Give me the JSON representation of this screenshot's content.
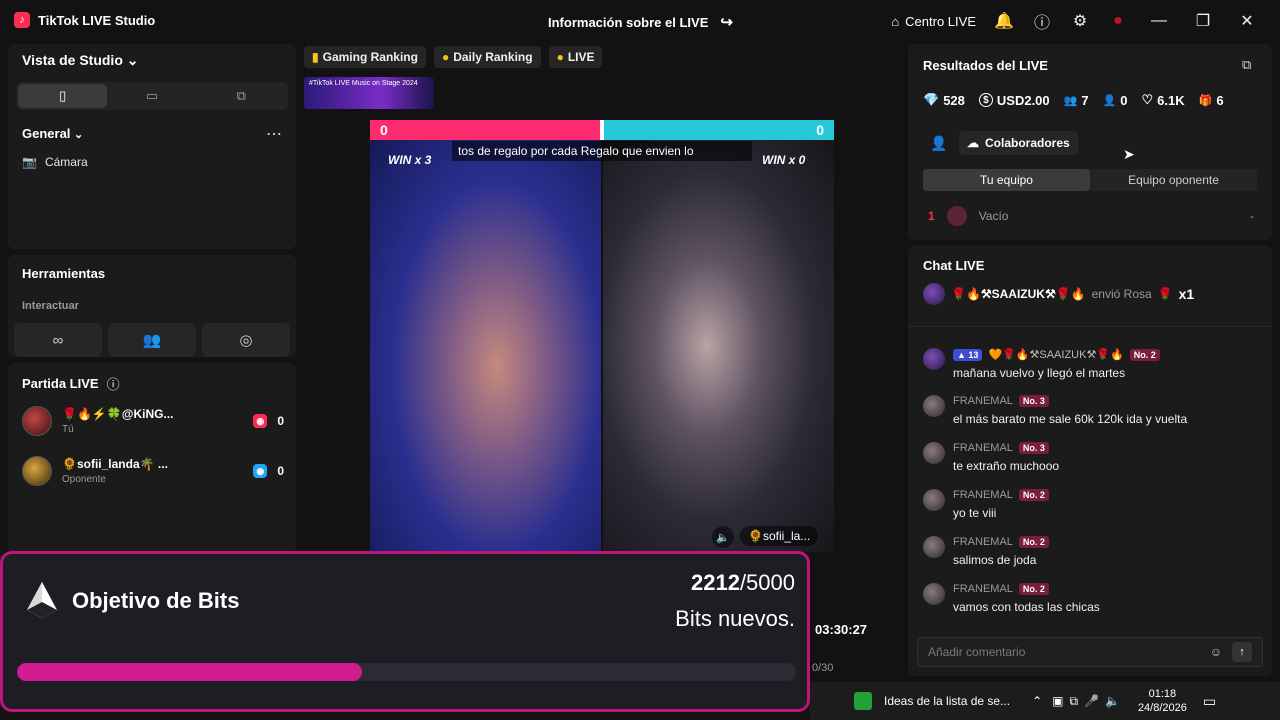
{
  "app": {
    "name": "TikTok LIVE Studio",
    "center_title": "Información sobre el LIVE",
    "centro_label": "Centro LIVE"
  },
  "left": {
    "studio_view_label": "Vista de Studio",
    "general_label": "General",
    "camera_label": "Cámara",
    "tools_label": "Herramientas",
    "interact_label": "Interactuar",
    "match_label": "Partida LIVE",
    "players": [
      {
        "name": "🌹🔥⚡🍀@KiNG...",
        "sub": "Tú",
        "score": "0",
        "tag_color": "#fe2c55"
      },
      {
        "name": "🌻sofii_landa🌴 ...",
        "sub": "Oponente",
        "score": "0",
        "tag_color": "#25a3f4"
      }
    ]
  },
  "center": {
    "rank_chips": [
      "Gaming Ranking",
      "Daily Ranking",
      "LIVE"
    ],
    "banner_text": "#TikTok LIVE Music on Stage 2024",
    "score_left": "0",
    "score_right": "0",
    "win_left": "WIN x 3",
    "win_right": "WIN x 0",
    "ticker": "tos de regalo por cada Regalo que envien lo",
    "opponent_tag": "🌻sofii_la...",
    "timer": "03:30:27",
    "count": "0/30"
  },
  "right": {
    "results_title": "Resultados del LIVE",
    "stats": [
      {
        "icon": "diamond-icon",
        "glyph": "💎",
        "value": "528"
      },
      {
        "icon": "dollar-icon",
        "glyph": "$",
        "value": "USD2.00"
      },
      {
        "icon": "viewers-icon",
        "glyph": "👥",
        "value": "7"
      },
      {
        "icon": "new-followers-icon",
        "glyph": "👤",
        "value": "0"
      },
      {
        "icon": "heart-icon",
        "glyph": "♡",
        "value": "6.1K"
      },
      {
        "icon": "gift-icon",
        "glyph": "🎁",
        "value": "6"
      }
    ],
    "collab_label": "Colaboradores",
    "team_tabs": [
      "Tu equipo",
      "Equipo oponente"
    ],
    "team_row": {
      "rank": "1",
      "name": "Vacío",
      "value": "-"
    },
    "chat_title": "Chat LIVE",
    "pinned": {
      "user": "🌹🔥⚒SAAIZUK⚒🌹🔥",
      "text": "envió Rosa",
      "count": "x1"
    },
    "messages": [
      {
        "user": "",
        "level": "13",
        "badge": "No. 2",
        "name_line": "🧡🌹🔥⚒SAAIZUK⚒🌹🔥",
        "text": "mañana vuelvo y llegó el martes"
      },
      {
        "user": "FRANEMAL",
        "badge": "No. 3",
        "text": "el más barato me sale 60k 120k ida y vuelta"
      },
      {
        "user": "FRANEMAL",
        "badge": "No. 3",
        "text": "te extraño muchooo"
      },
      {
        "user": "FRANEMAL",
        "badge": "No. 2",
        "text": "yo te viii"
      },
      {
        "user": "FRANEMAL",
        "badge": "No. 2",
        "text": "salimos de joda"
      },
      {
        "user": "FRANEMAL",
        "badge": "No. 2",
        "text": "vamos con todas las chicas"
      }
    ],
    "comment_placeholder": "Añadir comentario"
  },
  "bits": {
    "title": "Objetivo de Bits",
    "current": "2212",
    "target": "/5000",
    "subtitle": "Bits nuevos.",
    "progress": 0.4424
  },
  "taskbar": {
    "window_label": "Ideas de la lista de se...",
    "time": "01:18",
    "date": "24/8/2026"
  }
}
